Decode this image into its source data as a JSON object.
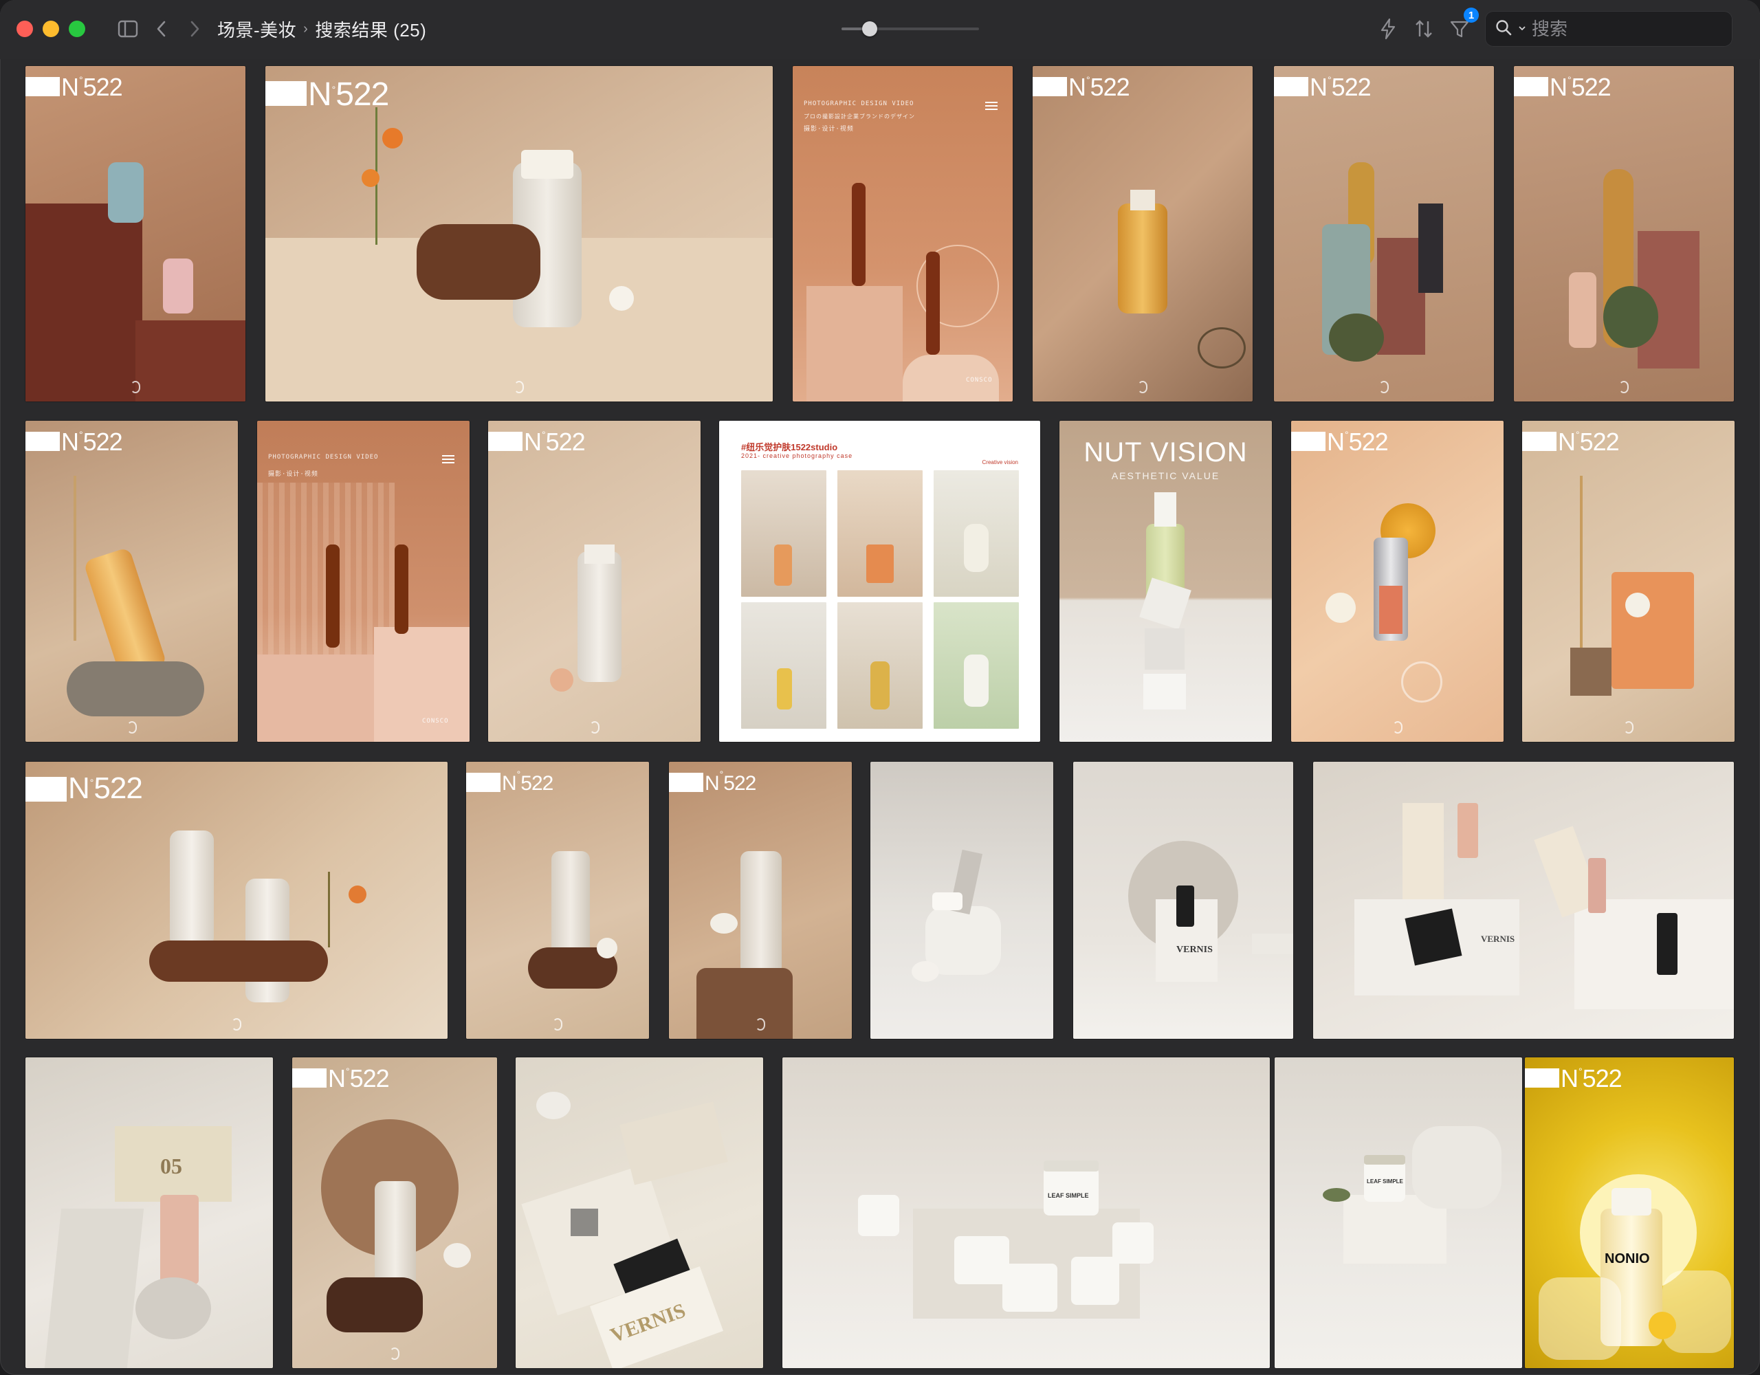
{
  "window": {
    "breadcrumb": {
      "parent": "场景-美妆",
      "current": "搜索结果 (25)"
    },
    "filter_badge": "1",
    "search": {
      "placeholder": "搜索"
    },
    "zoom_slider": {
      "value_fraction": 0.17
    }
  },
  "icons": {
    "sidebar": "sidebar-toggle-icon",
    "back": "chevron-left-icon",
    "forward": "chevron-right-icon",
    "quick_action": "lightning-icon",
    "sort": "sort-icon",
    "filter": "filter-icon",
    "search": "search-icon"
  },
  "tiles": [
    {
      "brand": "N°522",
      "kind": "photo"
    },
    {
      "brand": "N°522",
      "kind": "photo"
    },
    {
      "brand": "",
      "kind": "poster",
      "header": "PHOTOGRAPHIC DESIGN VIDEO",
      "line2": "プロの撮影設計企業ブランドのデザイン",
      "line3": "摄影·设计·视频",
      "footer": "CONSCO"
    },
    {
      "brand": "N°522",
      "kind": "photo"
    },
    {
      "brand": "N°522",
      "kind": "photo"
    },
    {
      "brand": "N°522",
      "kind": "photo"
    },
    {
      "brand": "N°522",
      "kind": "photo"
    },
    {
      "brand": "",
      "kind": "poster",
      "header": "PHOTOGRAPHIC DESIGN VIDEO",
      "line3": "摄影·设计·视频",
      "footer": "CONSCO"
    },
    {
      "brand": "N°522",
      "kind": "photo"
    },
    {
      "brand": "",
      "kind": "collage",
      "title": "#纽乐觉护肤1522studio",
      "subtitle": "2021- creative photography case",
      "right": "Creative vision"
    },
    {
      "brand": "",
      "kind": "poster",
      "heading": "NUT VISION",
      "subheading": "AESTHETIC VALUE"
    },
    {
      "brand": "N°522",
      "kind": "photo"
    },
    {
      "brand": "N°522",
      "kind": "photo"
    },
    {
      "brand": "N°522",
      "kind": "photo"
    },
    {
      "brand": "N°522",
      "kind": "photo"
    },
    {
      "brand": "N°522",
      "kind": "photo"
    },
    {
      "brand": "",
      "kind": "photo"
    },
    {
      "brand": "",
      "kind": "photo",
      "label": "VERNIS"
    },
    {
      "brand": "",
      "kind": "photo",
      "label": "VERNIS"
    },
    {
      "brand": "",
      "kind": "photo",
      "label": "05"
    },
    {
      "brand": "N°522",
      "kind": "photo"
    },
    {
      "brand": "",
      "kind": "photo",
      "label": "VERNIS"
    },
    {
      "brand": "",
      "kind": "photo",
      "label": "LEAF SIMPLE"
    },
    {
      "brand": "",
      "kind": "photo",
      "label": "LEAF SIMPLE"
    },
    {
      "brand": "N°522",
      "kind": "photo",
      "label": "NONIO"
    }
  ]
}
